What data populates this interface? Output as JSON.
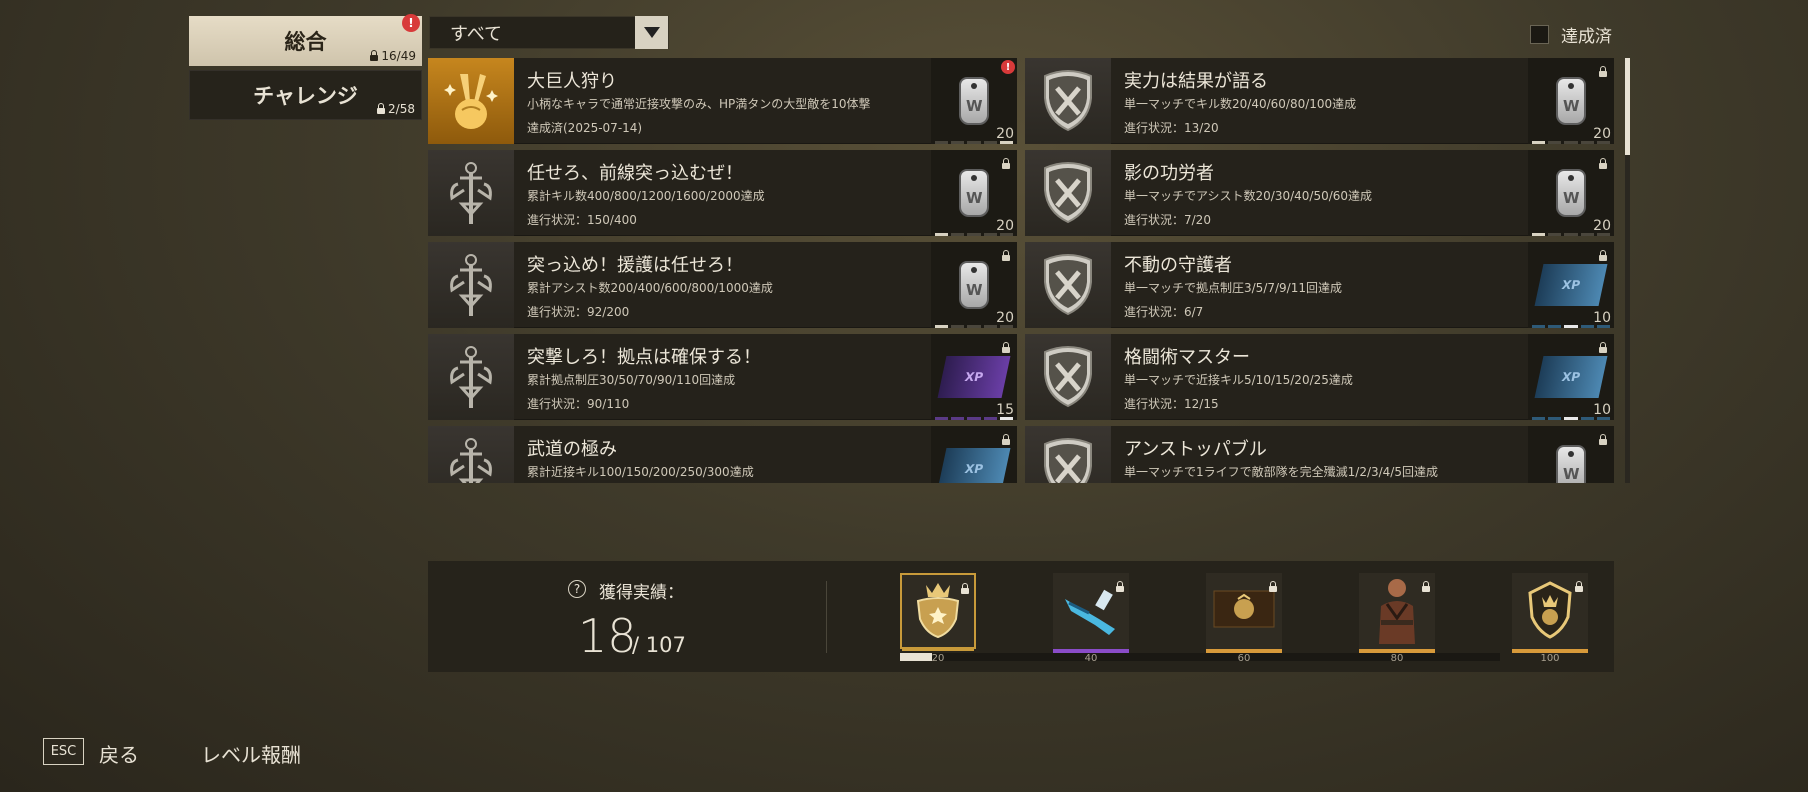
{
  "sidebar": {
    "tabs": [
      {
        "label": "総合",
        "count": "16/49",
        "alert": "!"
      },
      {
        "label": "チャレンジ",
        "count": "2/58"
      }
    ]
  },
  "filter": {
    "selected": "すべて"
  },
  "completed_toggle": {
    "label": "達成済",
    "checked": false
  },
  "achievements": [
    {
      "title": "大巨人狩り",
      "desc": "小柄なキャラで通常近接攻撃のみ、HP満タンの大型敵を10体撃",
      "progress": "達成済(2025-07-14)",
      "reward": "dogtag",
      "amount": "20",
      "alert": "!"
    },
    {
      "title": "実力は結果が語る",
      "desc": "単一マッチでキル数20/40/60/80/100達成",
      "progress": "進行状況：13/20",
      "reward": "dogtag",
      "amount": "20"
    },
    {
      "title": "任せろ、前線突っ込むぜ！",
      "desc": "累計キル数400/800/1200/1600/2000達成",
      "progress": "進行状況：150/400",
      "reward": "dogtag",
      "amount": "20"
    },
    {
      "title": "影の功労者",
      "desc": "単一マッチでアシスト数20/30/40/50/60達成",
      "progress": "進行状況：7/20",
      "reward": "dogtag",
      "amount": "20"
    },
    {
      "title": "突っ込め！援護は任せろ！",
      "desc": "累計アシスト数200/400/600/800/1000達成",
      "progress": "進行状況：92/200",
      "reward": "dogtag",
      "amount": "20"
    },
    {
      "title": "不動の守護者",
      "desc": "単一マッチで拠点制圧3/5/7/9/11回達成",
      "progress": "進行状況：6/7",
      "reward": "xp-blue",
      "amount": "10",
      "reward_text": "XP"
    },
    {
      "title": "突撃しろ！拠点は確保する！",
      "desc": "累計拠点制圧30/50/70/90/110回達成",
      "progress": "進行状況：90/110",
      "reward": "xp-purple",
      "amount": "15",
      "reward_text": "XP"
    },
    {
      "title": "格闘術マスター",
      "desc": "単一マッチで近接キル5/10/15/20/25達成",
      "progress": "進行状況：12/15",
      "reward": "xp-blue",
      "amount": "10",
      "reward_text": "XP"
    },
    {
      "title": "武道の極み",
      "desc": "累計近接キル100/150/200/250/300達成",
      "progress": "",
      "reward": "xp-blue",
      "amount": "",
      "reward_text": "XP"
    },
    {
      "title": "アンストッパブル",
      "desc": "単一マッチで1ライフで敵部隊を完全殲滅1/2/3/4/5回達成",
      "progress": "",
      "reward": "dogtag",
      "amount": ""
    }
  ],
  "summary": {
    "label": "獲得実績：",
    "help": "?",
    "earned": "18",
    "total": "/ 107",
    "milestones": [
      {
        "value": "20",
        "icon": "crown-badge-icon",
        "bar_color": "#c89a3a"
      },
      {
        "value": "40",
        "icon": "rifle-skin-icon",
        "bar_color": "#8a4cc8"
      },
      {
        "value": "60",
        "icon": "emblem-card-icon",
        "bar_color": "#d89a3a"
      },
      {
        "value": "80",
        "icon": "character-skin-icon",
        "bar_color": "#d89a3a"
      },
      {
        "value": "100",
        "icon": "gold-shield-icon",
        "bar_color": "#d89a3a"
      }
    ],
    "progress_fraction": 0.9
  },
  "footer": {
    "esc_key": "ESC",
    "back": "戻る",
    "level_reward": "レベル報酬"
  }
}
